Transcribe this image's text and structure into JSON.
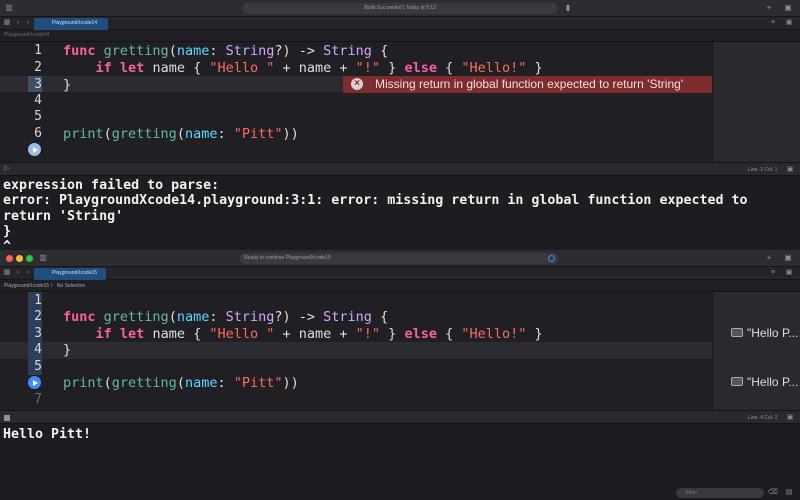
{
  "window1": {
    "activity_status": "Build Succeeded | Today at 8:12",
    "tab_label": "PlaygroundXcode14",
    "jump_path": "PlaygroundXcode14",
    "editor": {
      "line_numbers": [
        "1",
        "2",
        "3",
        "4",
        "5",
        "6"
      ],
      "code": {
        "l1_kw": "func",
        "l1_fn": "gretting",
        "l1_open": "(",
        "l1_param": "name",
        "l1_colon": ": ",
        "l1_type": "String",
        "l1_rest": "?) -> ",
        "l1_rettype": "String",
        "l1_brace": " {",
        "l2_indent": "    ",
        "l2_if": "if",
        "l2_let": "let",
        "l2_name": " name { ",
        "l2_str1": "\"Hello \"",
        "l2_plus": " + name + ",
        "l2_str2": "\"!\"",
        "l2_close": " } ",
        "l2_else": "else",
        "l2_open": " { ",
        "l2_str3": "\"Hello!\"",
        "l2_end": " }",
        "l3": "}",
        "l6_call": "print",
        "l6_open": "(",
        "l6_fn": "gretting",
        "l6_open2": "(",
        "l6_param": "name",
        "l6_colon": ": ",
        "l6_str": "\"Pitt\"",
        "l6_close": "))"
      },
      "error_message": "Missing return in global function expected to return 'String'"
    },
    "status": {
      "position": "Line: 1  Col: 1"
    },
    "console": {
      "line1": "expression failed to parse:",
      "line2": "error: PlaygroundXcode14.playground:3:1: error: missing return in global function expected to",
      "line3": "return 'String'",
      "line4": "}",
      "line5": "^"
    }
  },
  "window2": {
    "activity_status": "Ready to continue PlaygroundXcode15",
    "tab_label": "PlaygroundXcode15",
    "jump_path": "PlaygroundXcode15",
    "jump_sep": "〉",
    "jump_selection": "No Selection",
    "editor": {
      "line_numbers": [
        "1",
        "2",
        "3",
        "4",
        "5",
        "6",
        "7"
      ],
      "results": [
        "\"Hello P...",
        "\"Hello P..."
      ]
    },
    "status": {
      "position": "Line: 4  Col: 2"
    },
    "console": {
      "output": "Hello Pitt!"
    },
    "filter_placeholder": "Filter"
  },
  "colors": {
    "accent_blue": "#3d8ef5",
    "error_red": "#7d2d2d",
    "keyword": "#fc5fa3",
    "string": "#fc6a5d",
    "type": "#d0a8ff"
  }
}
